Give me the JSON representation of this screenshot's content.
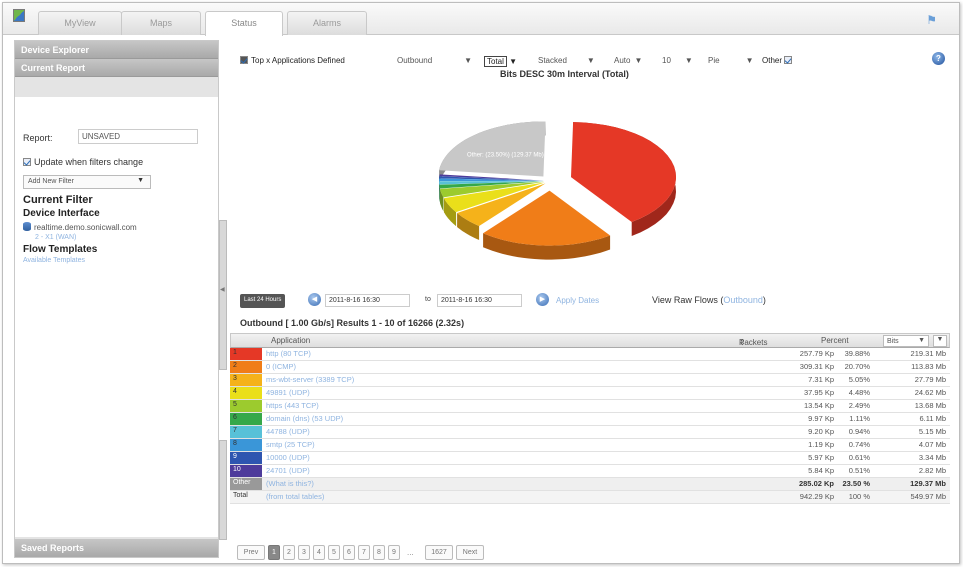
{
  "tabs": [
    "MyView",
    "Maps",
    "Status",
    "Alarms"
  ],
  "active_tab": "Status",
  "sidebar": {
    "device_explorer": "Device Explorer",
    "current_report": "Current Report",
    "report_label": "Report:",
    "report_value": "UNSAVED",
    "update_label": "Update when filters change",
    "add_filter": "Add New Filter",
    "current_filter": "Current Filter",
    "device_interface": "Device Interface",
    "device_name": "realtime.demo.sonicwall.com",
    "device_sub": "2 - X1 (WAN)",
    "flow_templates": "Flow Templates",
    "available_templates": "Available Templates",
    "saved_reports": "Saved Reports"
  },
  "controls": {
    "top_apps": "Top x Applications Defined",
    "direction": "Outbound",
    "total": "Total",
    "stacked": "Stacked",
    "auto": "Auto",
    "count": "10",
    "chart_type": "Pie",
    "other": "Other"
  },
  "chart_title": "Bits DESC 30m Interval (Total)",
  "pie_label": "Other: (23.50%) (129.37 Mb)",
  "chart_data": {
    "type": "pie",
    "title": "Bits DESC 30m Interval (Total)",
    "categories": [
      "http (80 TCP)",
      "0 (ICMP)",
      "ms-wbt-server (3389 TCP)",
      "49891 (UDP)",
      "https (443 TCP)",
      "domain (dns) (53 UDP)",
      "44788 (UDP)",
      "smtp (25 TCP)",
      "10000 (UDP)",
      "24701 (UDP)",
      "Other"
    ],
    "values": [
      39.88,
      20.7,
      5.05,
      4.48,
      2.49,
      1.11,
      0.94,
      0.74,
      0.61,
      0.51,
      23.5
    ],
    "colors": [
      "#e53826",
      "#f07d18",
      "#f5b21a",
      "#eadf1a",
      "#9ccb2e",
      "#35a84a",
      "#58c1d8",
      "#3a96d8",
      "#2e55b0",
      "#4e3b9b",
      "#c8c8c8"
    ]
  },
  "range": {
    "last24": "Last 24 Hours",
    "from": "2011-8-16 16:30",
    "to_label": "to",
    "to": "2011-8-16 16:30",
    "apply": "Apply Dates",
    "raw_flows": "View Raw Flows (",
    "raw_flows_link": "Outbound",
    "raw_flows_end": ")"
  },
  "summary": "Outbound [ 1.00 Gb/s] Results 1 - 10 of 16266 (2.32s)",
  "table": {
    "col_app": "Application",
    "col_packets": "Packets",
    "col_percent": "Percent",
    "col_unit": "Bits",
    "rows": [
      {
        "rank": "1",
        "app": "http (80 TCP)",
        "packets": "257.79 Kp",
        "percent": "39.88%",
        "bits": "219.31 Mb"
      },
      {
        "rank": "2",
        "app": "0 (ICMP)",
        "packets": "309.31 Kp",
        "percent": "20.70%",
        "bits": "113.83 Mb"
      },
      {
        "rank": "3",
        "app": "ms-wbt-server (3389 TCP)",
        "packets": "7.31 Kp",
        "percent": "5.05%",
        "bits": "27.79 Mb"
      },
      {
        "rank": "4",
        "app": "49891 (UDP)",
        "packets": "37.95 Kp",
        "percent": "4.48%",
        "bits": "24.62 Mb"
      },
      {
        "rank": "5",
        "app": "https (443 TCP)",
        "packets": "13.54 Kp",
        "percent": "2.49%",
        "bits": "13.68 Mb"
      },
      {
        "rank": "6",
        "app": "domain (dns) (53 UDP)",
        "packets": "9.97 Kp",
        "percent": "1.11%",
        "bits": "6.11 Mb"
      },
      {
        "rank": "7",
        "app": "44788 (UDP)",
        "packets": "9.20 Kp",
        "percent": "0.94%",
        "bits": "5.15 Mb"
      },
      {
        "rank": "8",
        "app": "smtp (25 TCP)",
        "packets": "1.19 Kp",
        "percent": "0.74%",
        "bits": "4.07 Mb"
      },
      {
        "rank": "9",
        "app": "10000 (UDP)",
        "packets": "5.97 Kp",
        "percent": "0.61%",
        "bits": "3.34 Mb"
      },
      {
        "rank": "10",
        "app": "24701 (UDP)",
        "packets": "5.84 Kp",
        "percent": "0.51%",
        "bits": "2.82 Mb"
      }
    ],
    "other": {
      "rank": "Other",
      "app": "(What is this?)",
      "packets": "285.02 Kp",
      "percent": "23.50 %",
      "bits": "129.37 Mb"
    },
    "total": {
      "rank": "Total",
      "app": "(from total tables)",
      "packets": "942.29 Kp",
      "percent": "100 %",
      "bits": "549.97 Mb"
    }
  },
  "pager": {
    "prev": "Prev",
    "pages": [
      "1",
      "2",
      "3",
      "4",
      "5",
      "6",
      "7",
      "8",
      "9"
    ],
    "ellipsis": "...",
    "last": "1627",
    "next": "Next"
  }
}
